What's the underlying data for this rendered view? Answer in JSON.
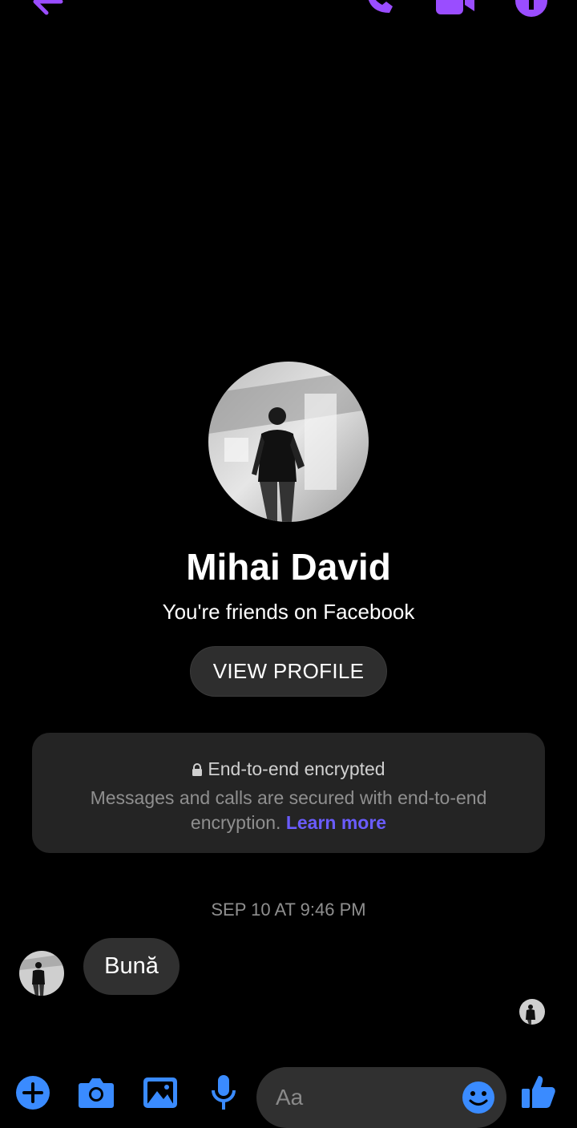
{
  "header": {
    "back_icon": "arrow-left-icon",
    "actions": [
      "phone-icon",
      "video-camera-icon",
      "info-icon"
    ],
    "accent_color": "#9a4dff"
  },
  "profile": {
    "name": "Mihai David",
    "relationship": "You're friends on Facebook",
    "view_profile_label": "VIEW PROFILE"
  },
  "encryption": {
    "icon": "lock-icon",
    "title": "End-to-end encrypted",
    "body": "Messages and calls are secured with end-to-end encryption.",
    "link": "Learn more",
    "link_color": "#6a5cff"
  },
  "conversation": {
    "timestamp": "SEP 10 AT 9:46 PM",
    "messages": [
      {
        "sender": "Mihai David",
        "text": "Bună"
      }
    ]
  },
  "composer": {
    "placeholder": "Aa",
    "icons": [
      "plus-icon",
      "camera-icon",
      "gallery-icon",
      "microphone-icon",
      "emoji-icon",
      "thumbs-up-icon"
    ],
    "accent_color": "#3a8bff"
  }
}
